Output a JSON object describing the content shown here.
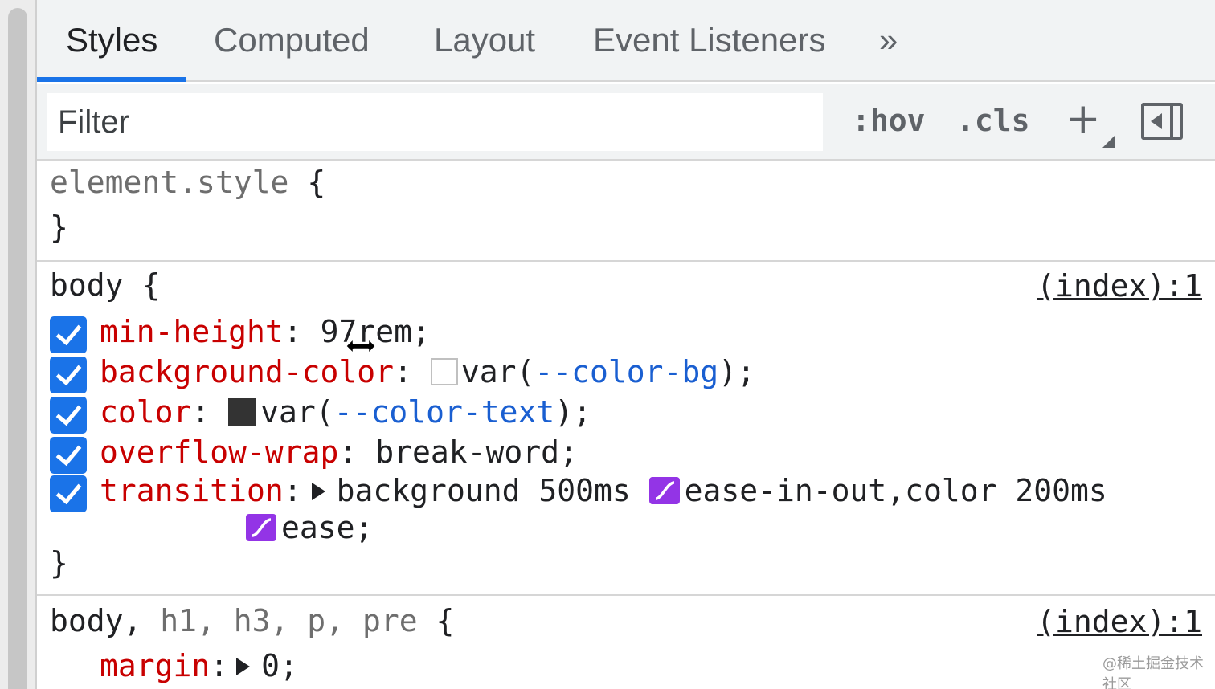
{
  "tabs": [
    {
      "label": "Styles",
      "active": true
    },
    {
      "label": "Computed",
      "active": false
    },
    {
      "label": "Layout",
      "active": false
    },
    {
      "label": "Event Listeners",
      "active": false
    }
  ],
  "tab_more_symbol": "»",
  "toolbar": {
    "filter_placeholder": "Filter",
    "hov_label": ":hov",
    "cls_label": ".cls",
    "plus_label": "+"
  },
  "element_style": {
    "selector": "element.style",
    "open_brace": "{",
    "close_brace": "}"
  },
  "rule_body": {
    "selector": "body",
    "open_brace": "{",
    "source": "(index):1",
    "close_brace": "}",
    "decls": [
      {
        "prop": "min-height",
        "colon": ":",
        "value": "97rem;"
      },
      {
        "prop": "background-color",
        "colon": ":",
        "value_pre": "var(",
        "value_var": "--color-bg",
        "value_post": ");",
        "swatch_color": "#ffffff"
      },
      {
        "prop": "color",
        "colon": ":",
        "value_pre": "var(",
        "value_var": "--color-text",
        "value_post": ");",
        "swatch_color": "#333333"
      },
      {
        "prop": "overflow-wrap",
        "colon": ":",
        "value": "break-word;"
      },
      {
        "prop": "transition",
        "colon": ":",
        "value_a": "background 500ms",
        "value_b": "ease-in-out,color 200ms",
        "value_c": "ease;"
      }
    ]
  },
  "rule_multi": {
    "selector_main": "body,",
    "selector_rest": "h1, h3, p, pre",
    "open_brace": "{",
    "source": "(index):1",
    "decls": [
      {
        "prop": "margin",
        "colon": ":",
        "value": "0;"
      }
    ]
  },
  "colors": {
    "accent": "#1a73e8",
    "property": "#c80000",
    "variable": "#1a5fd1",
    "easing": "#9334e6"
  },
  "icons": [
    "chevron-double-right-icon",
    "plus-icon",
    "sidebar-toggle-icon",
    "checkbox-checked-icon",
    "easing-curve-icon",
    "expand-triangle-icon",
    "resize-cursor-icon"
  ],
  "watermark": "@稀土掘金技术社区"
}
